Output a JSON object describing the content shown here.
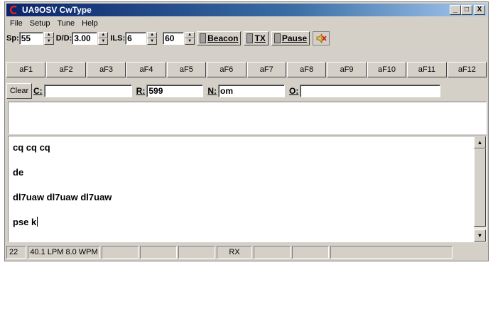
{
  "window": {
    "title": "UA9OSV CwType",
    "minimize": "_",
    "maximize": "□",
    "close": "X"
  },
  "menu": [
    "File",
    "Setup",
    "Tune",
    "Help"
  ],
  "controls": {
    "sp_label": "Sp:",
    "sp_value": "55",
    "dd_label": "D/D:",
    "dd_value": "3.00",
    "ils_label": "ILS:",
    "ils_value": "6",
    "vol_value": "60",
    "beacon_label": "Beacon",
    "tx_label": "TX",
    "pause_label": "Pause",
    "speaker_icon": "speaker-mute-icon"
  },
  "function_keys": [
    "aF1",
    "aF2",
    "aF3",
    "aF4",
    "aF5",
    "aF6",
    "aF7",
    "aF8",
    "aF9",
    "aF10",
    "aF11",
    "aF12"
  ],
  "qso": {
    "clear_label": "Clear",
    "c_label": "C:",
    "c_value": "",
    "r_label": "R:",
    "r_value": "599",
    "n_label": "N:",
    "n_value": "om",
    "o_label": "O:",
    "o_value": ""
  },
  "tx_text": [
    "cq cq cq",
    "de",
    "dl7uaw dl7uaw dl7uaw",
    "pse k"
  ],
  "status": {
    "count": "22",
    "speed": "40.1 LPM  8.0 WPM",
    "mode": "RX"
  },
  "colors": {
    "title_start": "#0a246a",
    "title_end": "#a6caf0",
    "app_icon": "#e02020",
    "face": "#d4d0c8"
  }
}
